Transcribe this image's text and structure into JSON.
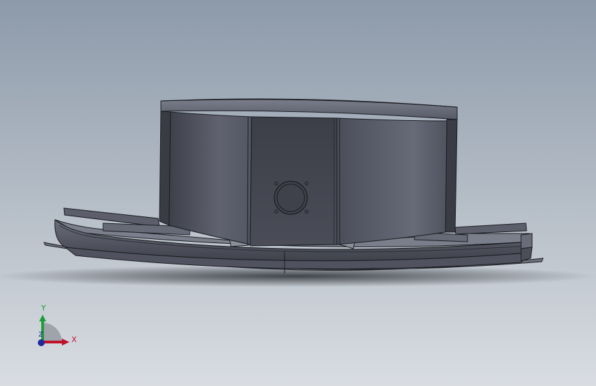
{
  "colors": {
    "background_top": "#8d9aaa",
    "background_bottom": "#d6dadf",
    "model_dark": "#42444f",
    "model_mid": "#5a5d6b",
    "model_light": "#6d717e",
    "edge": "#1b1c21",
    "axis_x": "#c0102a",
    "axis_y": "#1f9a3a",
    "axis_z": "#1e2a9c"
  },
  "triad": {
    "x_label": "X",
    "y_label": "Y",
    "z_label": "Z"
  },
  "icons": {
    "triad": "coordinate-triad-icon",
    "mount_hole": "mounting-hole-icon"
  }
}
